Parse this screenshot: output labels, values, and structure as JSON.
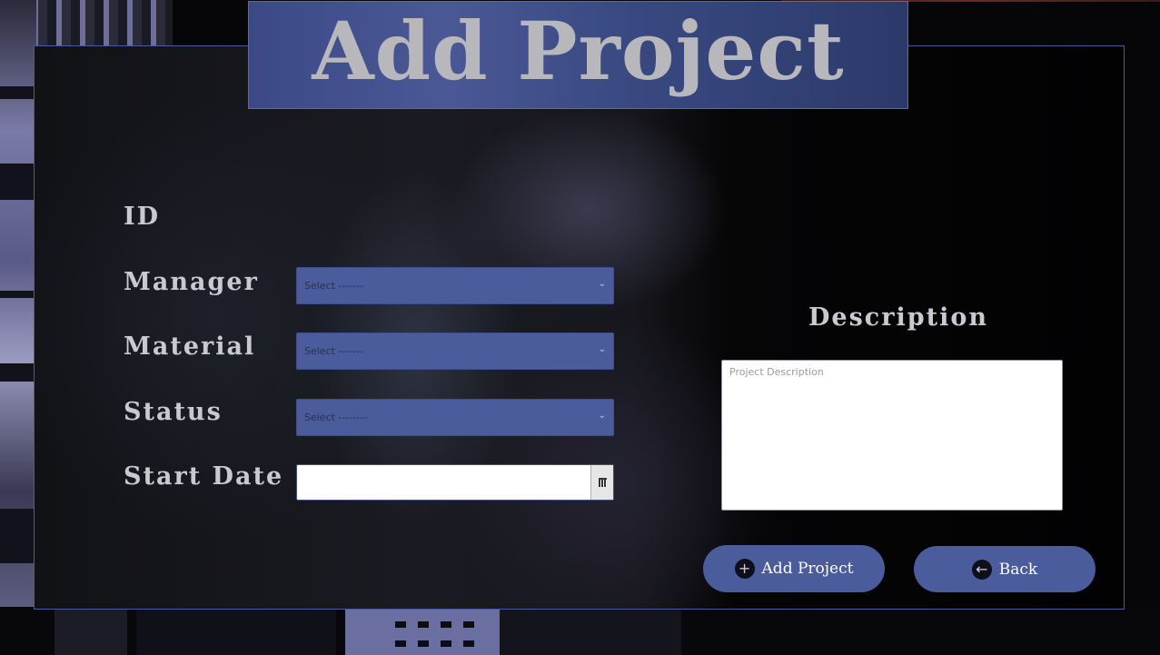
{
  "title": "Add Project",
  "form": {
    "id_label": "ID",
    "manager_label": "Manager",
    "manager_selected": "Select -------",
    "material_label": "Material",
    "material_selected": "Select -------",
    "status_label": "Status",
    "status_selected": "Select --------",
    "start_date_label": "Start Date",
    "start_date_value": ""
  },
  "description": {
    "label": "Description",
    "placeholder": "Project Description"
  },
  "buttons": {
    "add_label": "Add Project",
    "add_icon": "plus-icon",
    "back_label": "Back",
    "back_icon": "arrow-left-icon"
  },
  "colors": {
    "accent": "#4a5c9c",
    "title_bg": "#3b4a86",
    "label_text": "#c9c9cf"
  }
}
